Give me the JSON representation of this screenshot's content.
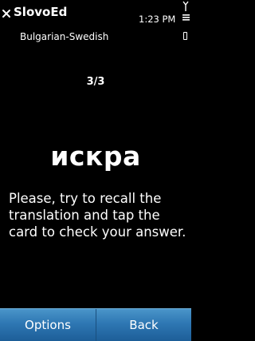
{
  "app": {
    "title": "SlovoEd",
    "subtitle": "Bulgarian-Swedish"
  },
  "status": {
    "time": "1:23 PM"
  },
  "card": {
    "counter": "3/3",
    "word": "искра",
    "instruction": "Please, try to recall the translation and tap the card to check your answer."
  },
  "softkeys": {
    "left": "Options",
    "right": "Back"
  },
  "icons": {
    "close": "close-icon",
    "signal": "signal-icon",
    "battery": "battery-icon"
  }
}
